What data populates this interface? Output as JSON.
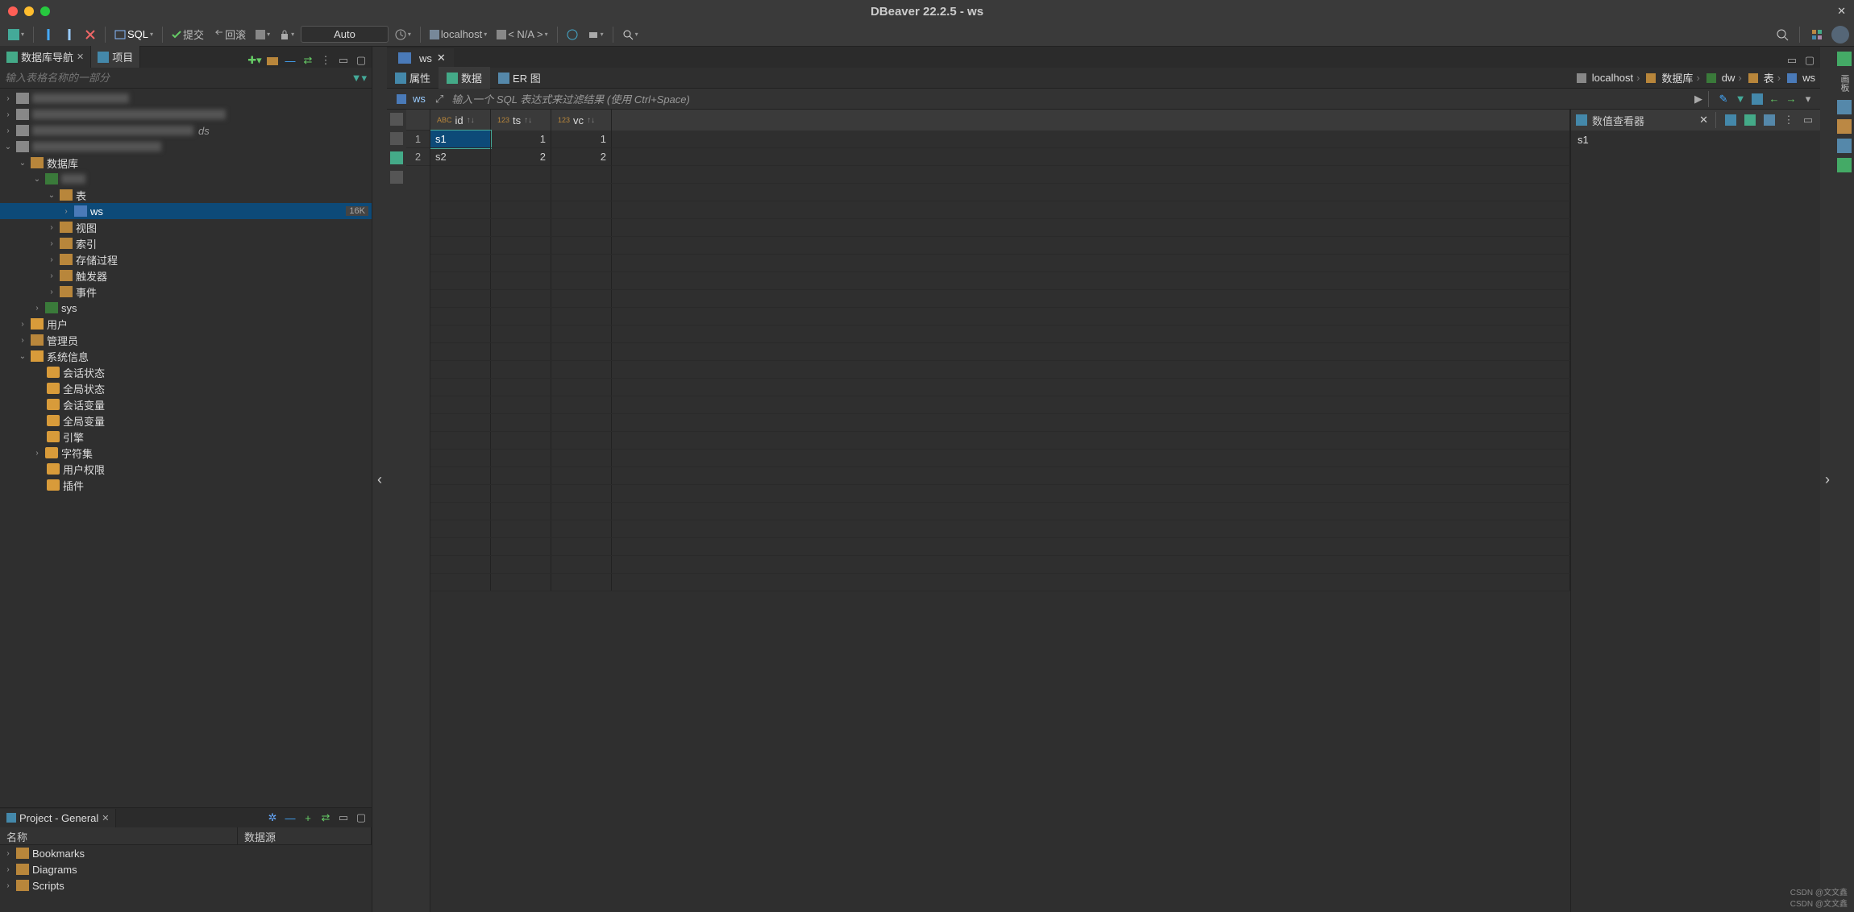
{
  "title": "DBeaver 22.2.5 - ws",
  "toolbar": {
    "sql": "SQL",
    "commit": "提交",
    "rollback": "回滚",
    "auto": "Auto",
    "localhost": "localhost",
    "na": "< N/A >"
  },
  "nav": {
    "tab_navigator": "数据库导航",
    "tab_project": "项目",
    "filter_placeholder": "输入表格名称的一部分",
    "blurred": [
      ".....",
      "...............",
      "..........  ds",
      "......."
    ],
    "database": "数据库",
    "hidden_conn": "...",
    "tables": "表",
    "ws": "ws",
    "ws_size": "16K",
    "views": "视图",
    "indexes": "索引",
    "procs": "存储过程",
    "triggers": "触发器",
    "events": "事件",
    "sys": "sys",
    "users": "用户",
    "admins": "管理员",
    "sysinfo": "系统信息",
    "sess_status": "会话状态",
    "glob_status": "全局状态",
    "sess_vars": "会话变量",
    "glob_vars": "全局变量",
    "engine": "引擎",
    "charset": "字符集",
    "user_priv": "用户权限",
    "plugins": "插件"
  },
  "project": {
    "title": "Project - General",
    "col_name": "名称",
    "col_ds": "数据源",
    "bookmarks": "Bookmarks",
    "diagrams": "Diagrams",
    "scripts": "Scripts"
  },
  "editor": {
    "tab": "ws",
    "sub_props": "属性",
    "sub_data": "数据",
    "sub_er": "ER 图",
    "crumb_localhost": "localhost",
    "crumb_db": "数据库",
    "crumb_dw": "dw",
    "crumb_tbl": "表",
    "crumb_ws": "ws",
    "ws_tag": "ws",
    "sql_placeholder": "输入一个 SQL 表达式来过滤结果 (使用 Ctrl+Space)",
    "cols": {
      "id": "id",
      "ts": "ts",
      "vc": "vc"
    },
    "type_abc": "ABC",
    "type_123": "123",
    "rows": [
      {
        "n": "1",
        "id": "s1",
        "ts": "1",
        "vc": "1"
      },
      {
        "n": "2",
        "id": "s2",
        "ts": "2",
        "vc": "2"
      }
    ]
  },
  "valueviewer": {
    "title": "数值查看器",
    "value": "s1"
  },
  "side_label": "画板",
  "watermark": "CSDN @文文鑫"
}
